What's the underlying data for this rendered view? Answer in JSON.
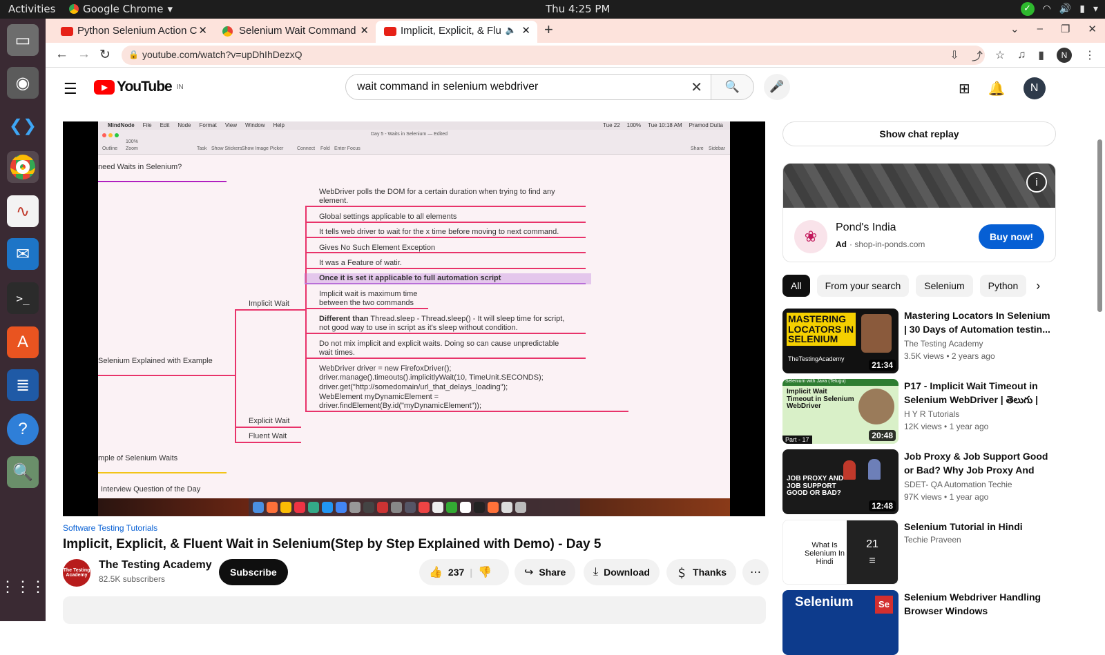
{
  "os": {
    "activities": "Activities",
    "app_name": "Google Chrome",
    "clock": "Thu  4:25 PM"
  },
  "browser": {
    "tabs": [
      {
        "label": "Python Selenium Action C",
        "icon": "youtube-icon"
      },
      {
        "label": "Selenium Wait Command",
        "icon": "chrome-icon"
      },
      {
        "label": "Implicit, Explicit, & Flu",
        "icon": "youtube-icon",
        "active": true
      }
    ],
    "url": "youtube.com/watch?v=upDhIhDezxQ",
    "profile_initial": "N"
  },
  "youtube": {
    "country": "IN",
    "search_query": "wait command in selenium webdriver",
    "avatar_initial": "N",
    "video": {
      "mindmap": {
        "app_menu": [
          "MindNode",
          "File",
          "Edit",
          "Node",
          "Format",
          "View",
          "Window",
          "Help"
        ],
        "menu_right": [
          "Tue 22",
          "100%",
          "Tue 10:18 AM",
          "Pramod Dutta"
        ],
        "doc_title": "Day 5 - Waits in Selenium — Edited",
        "toolbar_left": [
          "Outline",
          "Zoom"
        ],
        "zoom": "100%",
        "toolbar_mid": [
          "Task",
          "Show Stickers",
          "Show Image Picker",
          "Connect",
          "Fold",
          "Enter Focus"
        ],
        "toolbar_right": [
          "Share",
          "Sidebar"
        ],
        "left_top": "need Waits in Selenium?",
        "left_mid": "Selenium Explained with Example",
        "left_bottom1": "mple of Selenium Waits",
        "left_bottom2": "Interview Question of the Day",
        "branch_implicit": "Implicit Wait",
        "branch_explicit": "Explicit Wait",
        "branch_fluent": "Fluent Wait",
        "node1": "WebDriver polls the DOM for a certain duration when trying to find any",
        "node1b": "element.",
        "node2": "Global settings applicable to all elements",
        "node3": "It tells web driver to wait for the  x time before moving to next command.",
        "node4": "Gives No Such Element  Exception",
        "node5": "It was a Feature of watir.",
        "node6": "Once it is set it applicable to full automation script",
        "node7": "Implicit wait is maximum time",
        "node7b": "between the two commands",
        "node8_bold": "Different than",
        "node8": " Thread.sleep - Thread.sleep() - It will sleep time for script,",
        "node8b": "not good way to use in script as it's sleep without condition.",
        "node9": "Do not mix implicit and explicit waits. Doing so can cause unpredictable",
        "node9b": "wait times.",
        "code1": "WebDriver driver = new FirefoxDriver();",
        "code2": "driver.manage().timeouts().implicitlyWait(10, TimeUnit.SECONDS);",
        "code3": "driver.get(\"http://somedomain/url_that_delays_loading\");",
        "code4": "WebElement myDynamicElement =",
        "code5": "driver.findElement(By.id(\"myDynamicElement\"));"
      },
      "tagline": "Software Testing Tutorials",
      "title": "Implicit, Explicit, & Fluent Wait in Selenium(Step by Step Explained with Demo) - Day 5",
      "channel": "The Testing Academy",
      "channel_avatar_text": "The Testing Academy",
      "subscribers": "82.5K subscribers",
      "subscribe": "Subscribe",
      "likes": "237",
      "share": "Share",
      "download": "Download",
      "thanks": "Thanks"
    },
    "sidebar": {
      "chat_replay": "Show chat replay",
      "ad": {
        "name": "Pond's India",
        "badge": "Ad",
        "domain": "shop-in-ponds.com",
        "cta": "Buy now!"
      },
      "chips": [
        "All",
        "From your search",
        "Selenium",
        "Python"
      ],
      "recommendations": [
        {
          "title": "Mastering Locators In Selenium | 30 Days of Automation testin...",
          "channel": "The Testing Academy",
          "views": "3.5K views",
          "age": "2 years ago",
          "duration": "21:34",
          "thumb_text": "MASTERING LOCATORS IN SELENIUM",
          "thumb_sub": "TheTestingAcademy"
        },
        {
          "title": "P17 - Implicit Wait Timeout in Selenium WebDriver | తెలుగు |",
          "channel": "H Y R Tutorials",
          "views": "12K views",
          "age": "1 year ago",
          "duration": "20:48",
          "thumb_text": "Implicit Wait Timeout in Selenium WebDriver",
          "thumb_top": "Selenium with Java (Telugu)",
          "thumb_part": "Part - 17"
        },
        {
          "title": "Job Proxy & Job Support Good or Bad? Why Job Proxy And Jo...",
          "channel": "SDET- QA Automation Techie",
          "views": "97K views",
          "age": "1 year ago",
          "duration": "12:48",
          "thumb_text": "JOB PROXY AND JOB SUPPORT GOOD OR BAD?"
        },
        {
          "title": "Selenium Tutorial in Hindi",
          "channel": "Techie Praveen",
          "playlist_count": "21",
          "thumb_text": "What Is Selenium In Hindi"
        },
        {
          "title": "Selenium Webdriver Handling Browser Windows",
          "thumb_text": "Selenium"
        }
      ]
    }
  },
  "colors": {
    "youtube_red": "#ff0000",
    "link_blue": "#065fd4",
    "mindmap_line": "#e8336a",
    "tab_strip": "#fde3dc"
  }
}
